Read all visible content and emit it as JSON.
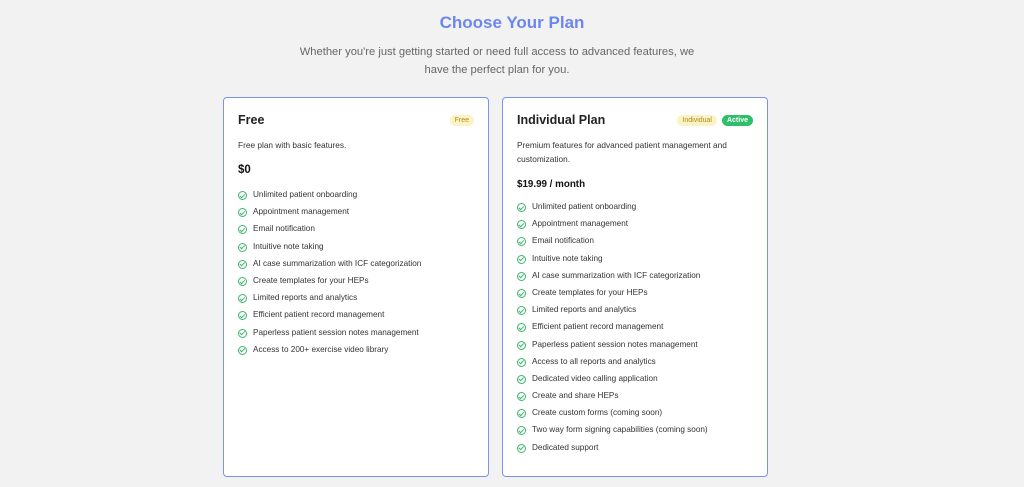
{
  "header": {
    "title": "Choose Your Plan",
    "subtitle": "Whether you're just getting started or need full access to advanced features, we have the perfect plan for you."
  },
  "colors": {
    "accent": "#6d86ee",
    "card_border": "#7b92ec",
    "check": "#3cb66b",
    "active_badge": "#2fbf6a"
  },
  "plans": [
    {
      "name": "Free",
      "badges": [
        "Free"
      ],
      "description": "Free plan with basic features.",
      "price": "$0",
      "check_icon": "check-circle-icon",
      "features": [
        "Unlimited patient onboarding",
        "Appointment management",
        "Email notification",
        "Intuitive note taking",
        "AI case summarization with ICF categorization",
        "Create templates for your HEPs",
        "Limited reports and analytics",
        "Efficient patient record management",
        "Paperless patient session notes management",
        "Access to 200+ exercise video library"
      ]
    },
    {
      "name": "Individual Plan",
      "badges": [
        "Individual",
        "Active"
      ],
      "description": "Premium features for advanced patient management and customization.",
      "price": "$19.99 / month",
      "check_icon": "check-circle-icon",
      "features": [
        "Unlimited patient onboarding",
        "Appointment management",
        "Email notification",
        "Intuitive note taking",
        "AI case summarization with ICF categorization",
        "Create templates for your HEPs",
        "Limited reports and analytics",
        "Efficient patient record management",
        "Paperless patient session notes management",
        "Access to all reports and analytics",
        "Dedicated video calling application",
        "Create and share HEPs",
        "Create custom forms (coming soon)",
        "Two way form signing capabilities (coming soon)",
        "Dedicated support"
      ]
    }
  ]
}
